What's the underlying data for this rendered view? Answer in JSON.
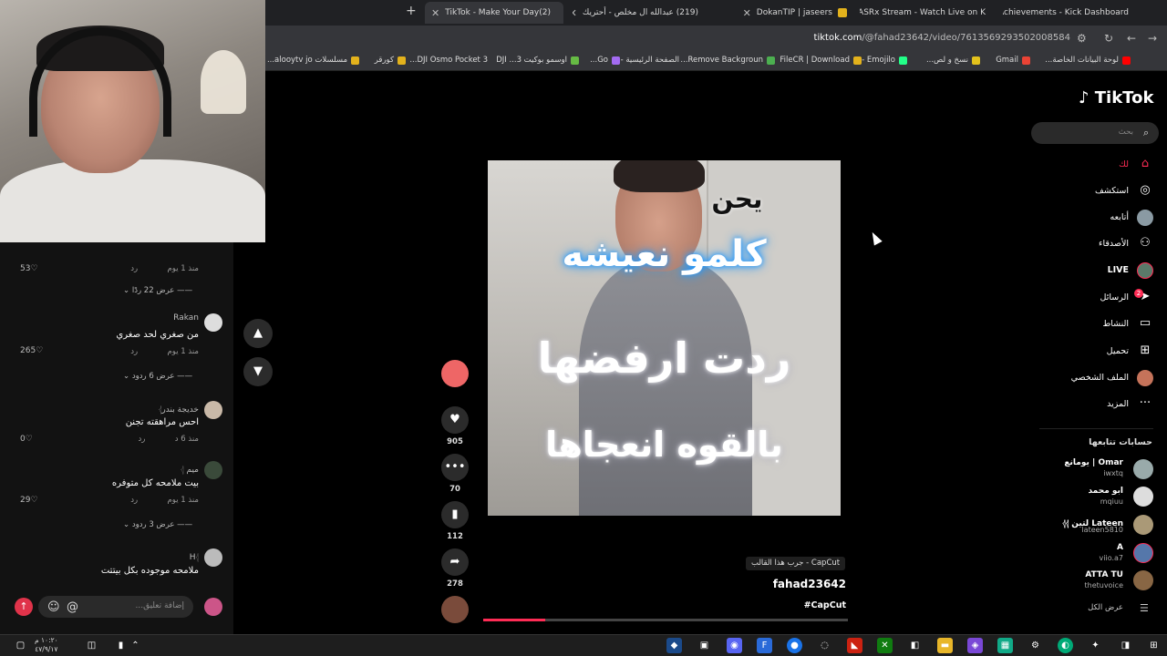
{
  "browser": {
    "tabs": [
      {
        "title": "Achievements - Kick Dashboard",
        "color": "#53fc18"
      },
      {
        "title": "JASRx Stream - Watch Live on K",
        "color": "#53fc18"
      },
      {
        "title": "DokanTIP | jaseers",
        "color": "#e3b21c"
      },
      {
        "title": "(219) عبدالله ال مخلص - أحتريك",
        "color": "#ff0000"
      },
      {
        "title": "(2)TikTok - Make Your Day",
        "color": "#ffffff"
      }
    ],
    "url_domain": "tiktok.com",
    "url_path": "/@fahad23642/video/7613569293502008584",
    "bookmarks": [
      "لوحة البيانات الخاصة...",
      "Gmail",
      "نسخ و لص...",
      "Emojilo -",
      "FileCR | Download",
      "Remove Backgroun...",
      "الصفحة الرئيسية -",
      "Go...",
      "اوسمو بوكيت 3... DJI",
      "DJI Osmo Pocket 3...",
      "كورقر",
      "مسلسلات alooytv jo..."
    ]
  },
  "comments": {
    "items": [
      {
        "name": "",
        "text": "",
        "time": "منذ 1 يوم",
        "reply": "رد",
        "likes": "53"
      },
      {
        "name": "Rakan",
        "text": "من صغري لحد صغري",
        "time": "منذ 1 يوم",
        "reply": "رد",
        "likes": "265"
      },
      {
        "name": "خديجة بندر𓂆",
        "text": "احس مراهقته تجنن",
        "time": "منذ 6 د",
        "reply": "رد",
        "likes": "0"
      },
      {
        "name": "ميم 𓂆",
        "text": "بيت ملامحه كل متوفره",
        "time": "منذ 1 يوم",
        "reply": "رد",
        "likes": "29"
      },
      {
        "name": "H𓂆",
        "text": "ملامحه موجوده بكل بيتتت",
        "time": "",
        "reply": "",
        "likes": ""
      }
    ],
    "view_replies": [
      "عرض 22 ردًا",
      "عرض 6 ردود",
      "عرض 3 ردود"
    ],
    "input_placeholder": "إضافة تعليق..."
  },
  "video": {
    "overlay_lines": [
      "يحن",
      "كلمو نعيشه",
      "ردت ارفضها",
      "بالقوه انعجاها"
    ],
    "actions": {
      "likes": "905",
      "comments": "70",
      "saves": "112",
      "shares": "278"
    },
    "capcut_tag": "CapCut - جرب هذا القالب",
    "author": "fahad23642",
    "hashtag": "#CapCut",
    "progress": 0.17
  },
  "sidebar": {
    "logo": "TikTok",
    "search_placeholder": "بحث",
    "nav": [
      "لك",
      "استكشف",
      "أتابعه",
      "الأصدقاء",
      "LIVE",
      "الرسائل",
      "النشاط",
      "تحميل",
      "الملف الشخصي",
      "المزيد"
    ],
    "messages_badge": "2",
    "following_title": "حسابات تتابعها",
    "following": [
      {
        "name": "Omar | يومانع",
        "user": "iwxtq"
      },
      {
        "name": "ابو محمد",
        "user": "mqiuu"
      },
      {
        "name": "Lateen لتين 𓂆𓂆",
        "user": "lateen5810"
      },
      {
        "name": "A",
        "user": "viio.a7"
      },
      {
        "name": "ATTA TU",
        "user": "thetuvoice"
      }
    ],
    "see_all": "عرض الكل"
  },
  "taskbar": {
    "time": "١٠:٢٠ م",
    "date": "٤٧/٩/١٧"
  },
  "colors": {
    "accent": "#fe2c55",
    "background": "#000000"
  }
}
